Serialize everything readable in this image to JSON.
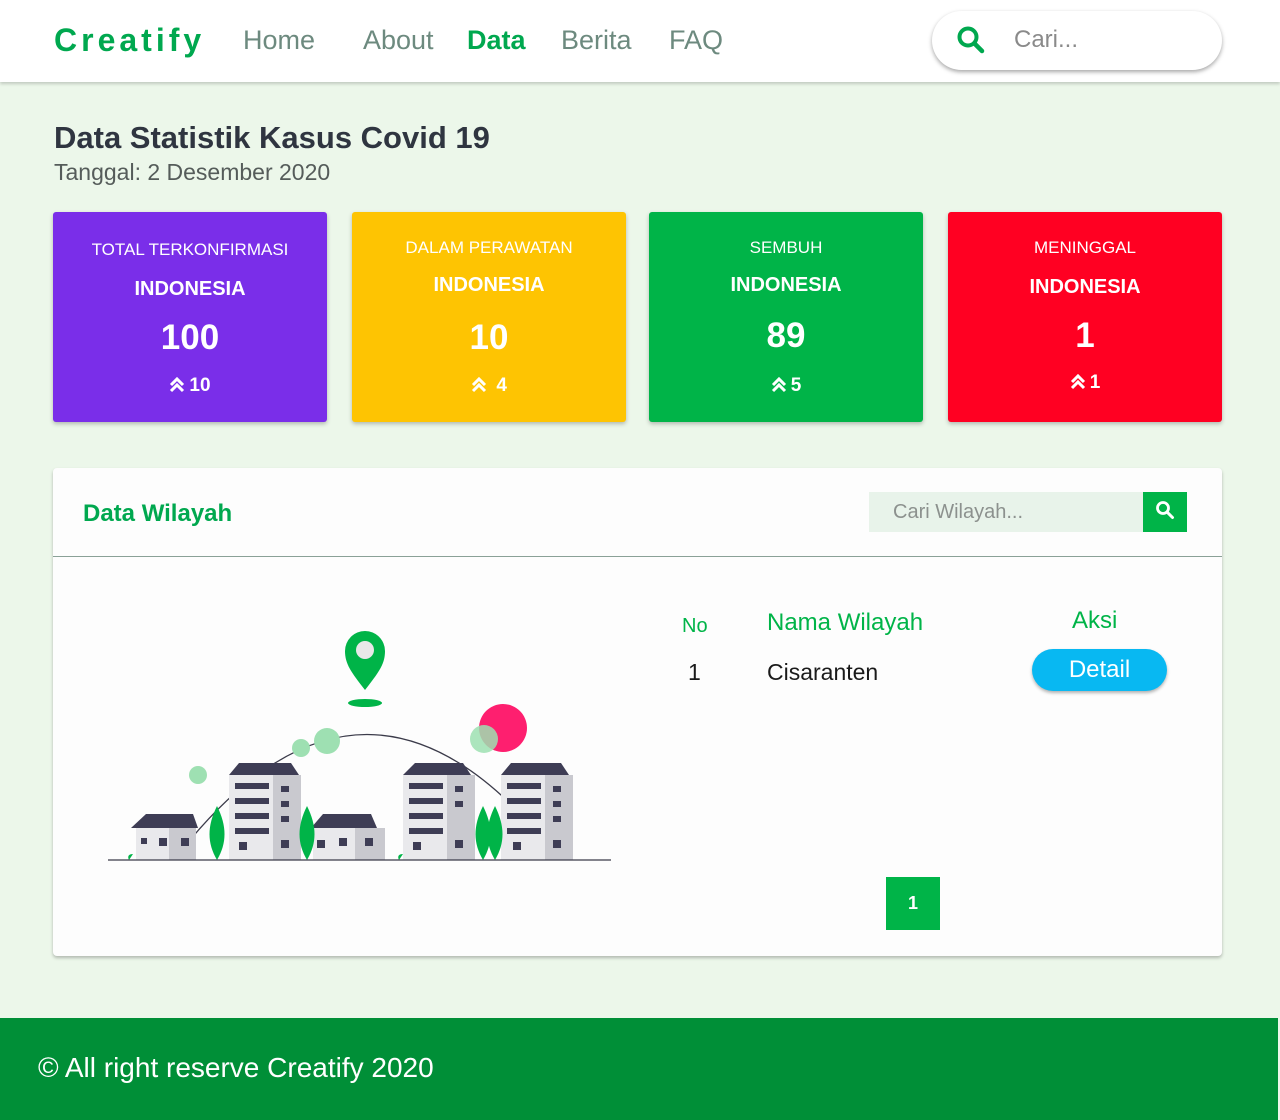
{
  "navbar": {
    "brand": "Creatify",
    "links": [
      {
        "label": "Home"
      },
      {
        "label": "About"
      },
      {
        "label": "Data"
      },
      {
        "label": "Berita"
      },
      {
        "label": "FAQ"
      }
    ],
    "active_link": "Data",
    "search_placeholder": "Cari...",
    "search_icon": "search-icon"
  },
  "header": {
    "title": "Data Statistik Kasus Covid 19",
    "date": "Tanggal: 2 Desember 2020"
  },
  "stats": [
    {
      "label": "TOTAL TERKONFIRMASI",
      "region": "INDONESIA",
      "value": "100",
      "delta": "10",
      "color": "#7a2ee9"
    },
    {
      "label": "DALAM PERAWATAN",
      "region": "INDONESIA",
      "value": "10",
      "delta": "4",
      "color": "#fec402"
    },
    {
      "label": "SEMBUH",
      "region": "INDONESIA",
      "value": "89",
      "delta": "5",
      "color": "#00b448"
    },
    {
      "label": "MENINGGAL",
      "region": "INDONESIA",
      "value": "1",
      "delta": "1",
      "color": "#ff0022"
    }
  ],
  "wilayah": {
    "title": "Data Wilayah",
    "search_placeholder": "Cari Wilayah...",
    "columns": {
      "no": "No",
      "nama": "Nama Wilayah",
      "aksi": "Aksi"
    },
    "rows": [
      {
        "no": "1",
        "nama": "Cisaranten",
        "action": "Detail"
      }
    ],
    "pagination": {
      "current": "1"
    }
  },
  "footer": {
    "text": "© All right reserve Creatify 2020"
  },
  "colors": {
    "brand": "#00a84f",
    "background": "#ecf7ea",
    "footer": "#008f37",
    "detail_button": "#08b8f2"
  }
}
